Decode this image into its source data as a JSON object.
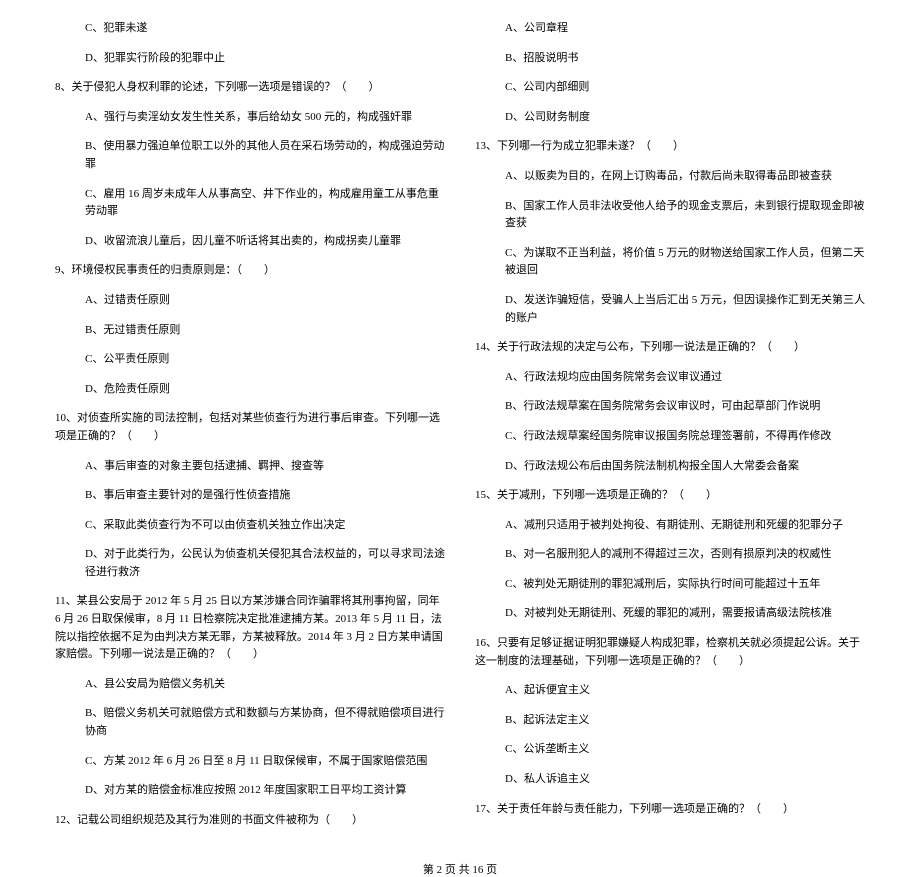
{
  "left": {
    "opt_c_7": "C、犯罪未遂",
    "opt_d_7": "D、犯罪实行阶段的犯罪中止",
    "q8": "8、关于侵犯人身权利罪的论述，下列哪一选项是错误的？（　　）",
    "q8_a": "A、强行与卖淫幼女发生性关系，事后给幼女 500 元的，构成强奸罪",
    "q8_b": "B、使用暴力强迫单位职工以外的其他人员在采石场劳动的，构成强迫劳动罪",
    "q8_c": "C、雇用 16 周岁未成年人从事高空、井下作业的，构成雇用童工从事危重劳动罪",
    "q8_d": "D、收留流浪儿童后，因儿童不听话将其出卖的，构成拐卖儿童罪",
    "q9": "9、环境侵权民事责任的归责原则是：（　　）",
    "q9_a": "A、过错责任原则",
    "q9_b": "B、无过错责任原则",
    "q9_c": "C、公平责任原则",
    "q9_d": "D、危险责任原则",
    "q10": "10、对侦查所实施的司法控制，包括对某些侦查行为进行事后审查。下列哪一选项是正确的？（　　）",
    "q10_a": "A、事后审查的对象主要包括逮捕、羁押、搜查等",
    "q10_b": "B、事后审查主要针对的是强行性侦查措施",
    "q10_c": "C、采取此类侦查行为不可以由侦查机关独立作出决定",
    "q10_d": "D、对于此类行为，公民认为侦查机关侵犯其合法权益的，可以寻求司法途径进行救济",
    "q11": "11、某县公安局于 2012 年 5 月 25 日以方某涉嫌合同诈骗罪将其刑事拘留，同年 6 月 26 日取保候审，8 月 11 日检察院决定批准逮捕方某。2013 年 5 月 11 日，法院以指控依据不足为由判决方某无罪，方某被释放。2014 年 3 月 2 日方某申请国家赔偿。下列哪一说法是正确的？（　　）",
    "q11_a": "A、县公安局为赔偿义务机关",
    "q11_b": "B、赔偿义务机关可就赔偿方式和数额与方某协商，但不得就赔偿项目进行协商",
    "q11_c": "C、方某 2012 年 6 月 26 日至 8 月 11 日取保候审，不属于国家赔偿范围",
    "q11_d": "D、对方某的赔偿金标准应按照 2012 年度国家职工日平均工资计算",
    "q12": "12、记载公司组织规范及其行为准则的书面文件被称为（　　）"
  },
  "right": {
    "q12_a": "A、公司章程",
    "q12_b": "B、招股说明书",
    "q12_c": "C、公司内部细则",
    "q12_d": "D、公司财务制度",
    "q13": "13、下列哪一行为成立犯罪未遂？（　　）",
    "q13_a": "A、以贩卖为目的，在网上订购毒品，付款后尚未取得毒品即被查获",
    "q13_b": "B、国家工作人员非法收受他人给予的现金支票后，未到银行提取现金即被查获",
    "q13_c": "C、为谋取不正当利益，将价值 5 万元的财物送给国家工作人员，但第二天被退回",
    "q13_d": "D、发送诈骗短信，受骗人上当后汇出 5 万元，但因误操作汇到无关第三人的账户",
    "q14": "14、关于行政法规的决定与公布，下列哪一说法是正确的？（　　）",
    "q14_a": "A、行政法规均应由国务院常务会议审议通过",
    "q14_b": "B、行政法规草案在国务院常务会议审议时，可由起草部门作说明",
    "q14_c": "C、行政法规草案经国务院审议报国务院总理签署前，不得再作修改",
    "q14_d": "D、行政法规公布后由国务院法制机构报全国人大常委会备案",
    "q15": "15、关于减刑，下列哪一选项是正确的？（　　）",
    "q15_a": "A、减刑只适用于被判处拘役、有期徒刑、无期徒刑和死缓的犯罪分子",
    "q15_b": "B、对一名服刑犯人的减刑不得超过三次，否则有损原判决的权威性",
    "q15_c": "C、被判处无期徒刑的罪犯减刑后，实际执行时间可能超过十五年",
    "q15_d": "D、对被判处无期徒刑、死缓的罪犯的减刑，需要报请高级法院核准",
    "q16": "16、只要有足够证据证明犯罪嫌疑人构成犯罪，检察机关就必须提起公诉。关于这一制度的法理基础，下列哪一选项是正确的？（　　）",
    "q16_a": "A、起诉便宜主义",
    "q16_b": "B、起诉法定主义",
    "q16_c": "C、公诉垄断主义",
    "q16_d": "D、私人诉追主义",
    "q17": "17、关于责任年龄与责任能力，下列哪一选项是正确的？（　　）"
  },
  "footer": "第 2 页 共 16 页"
}
